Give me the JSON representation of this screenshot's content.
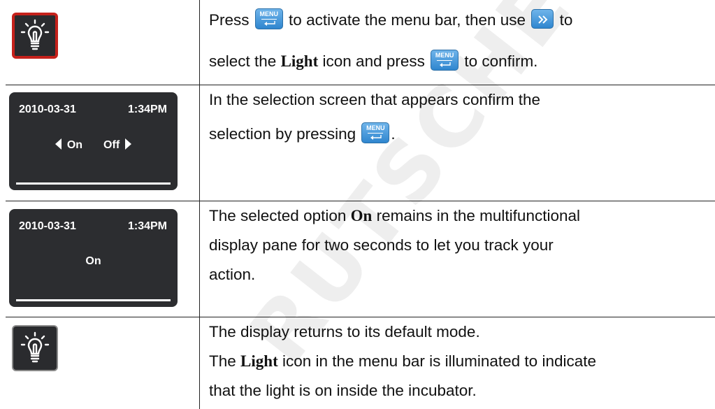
{
  "watermark": "RUTSCHER",
  "rows": [
    {
      "text_segments": [
        "Press",
        "to activate the menu bar, then use",
        "to",
        "select the",
        "Light",
        "icon and press",
        "to confirm."
      ]
    },
    {
      "screen": {
        "date": "2010-03-31",
        "time": "1:34",
        "meridiem": "PM",
        "option_on": "On",
        "option_off": "Off"
      },
      "text_segments": [
        "In the selection screen that appears confirm the",
        "selection by pressing",
        "."
      ]
    },
    {
      "screen": {
        "date": "2010-03-31",
        "time": "1:34",
        "meridiem": "PM",
        "selected": "On"
      },
      "text_segments": [
        "The selected option",
        "On",
        "remains in the multifunctional",
        "display pane for two seconds to let you track your",
        "action."
      ]
    },
    {
      "text_segments": [
        "The display returns to its default mode.",
        "The",
        "Light",
        "icon in the menu bar is illuminated to indicate",
        "that the light is on inside the incubator."
      ]
    }
  ],
  "keys": {
    "menu_label": "MENU"
  },
  "icons": {
    "light_active": "light-bulb-icon-red-frame",
    "light_default": "light-bulb-icon",
    "menu_key": "menu-enter-key-icon",
    "next_key": "double-chevron-right-key-icon"
  },
  "colors": {
    "highlight_frame": "#c5211b",
    "key_blue": "#3a8fd4",
    "screen_bg": "#2c2d30"
  }
}
